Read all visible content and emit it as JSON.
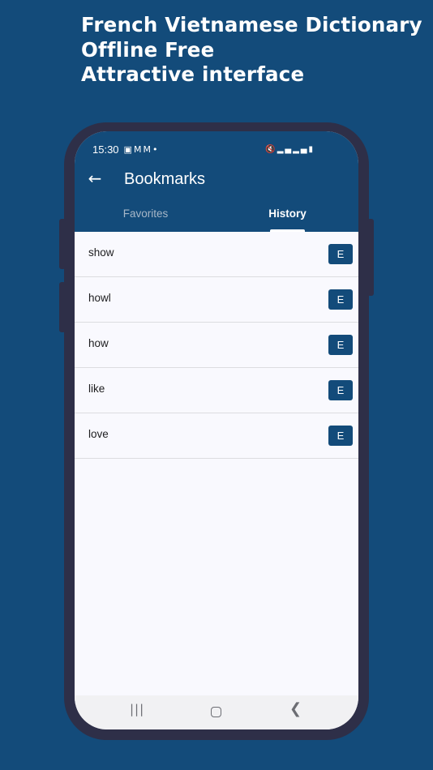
{
  "promo": {
    "line1": "French Vietnamese Dictionary",
    "line2": "Offline Free",
    "line3": "Attractive interface"
  },
  "status_bar": {
    "time": "15:30",
    "notification_icons": [
      "image-icon",
      "gmail-icon",
      "gmail-icon",
      "dot-icon"
    ],
    "system_icons": [
      "mute-icon",
      "signal-icon",
      "signal-icon",
      "battery-icon"
    ]
  },
  "app_bar": {
    "back_icon": "arrow-left-icon",
    "title": "Bookmarks"
  },
  "tabs": [
    {
      "label": "Favorites",
      "active": false
    },
    {
      "label": "History",
      "active": true
    }
  ],
  "history": [
    {
      "word": "show",
      "lang": "E"
    },
    {
      "word": "howl",
      "lang": "E"
    },
    {
      "word": "how",
      "lang": "E"
    },
    {
      "word": "like",
      "lang": "E"
    },
    {
      "word": "love",
      "lang": "E"
    }
  ],
  "nav_bar": {
    "recents_icon": "recents-icon",
    "home_icon": "home-icon",
    "back_icon": "back-chevron-icon"
  },
  "colors": {
    "brand": "#134b7a",
    "phone_frame": "#2e2f48",
    "screen_bg": "#f9f9fe"
  }
}
